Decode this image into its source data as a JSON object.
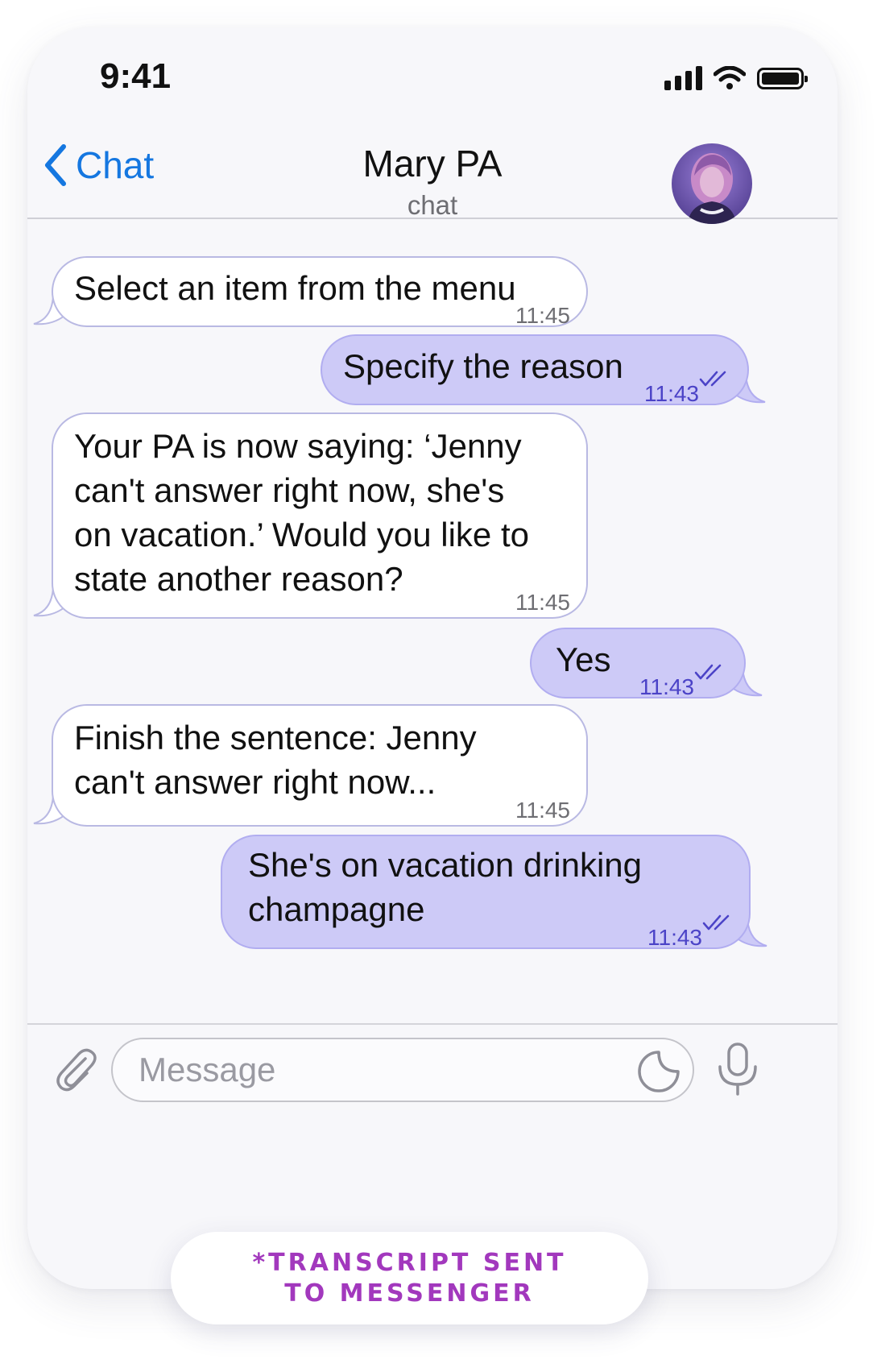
{
  "status_bar": {
    "time": "9:41"
  },
  "header": {
    "back_label": "Chat",
    "title": "Mary PA",
    "subtitle": "chat"
  },
  "messages": [
    {
      "direction": "incoming",
      "text": "Select an item from the menu",
      "time": "11:45"
    },
    {
      "direction": "outgoing",
      "text": "Specify the reason",
      "time": "11:43",
      "status": "read"
    },
    {
      "direction": "incoming",
      "text": "Your PA is now saying: ‘Jenny\ncan't answer right now, she's\non vacation.’ Would you like to\nstate another reason?",
      "time": "11:45"
    },
    {
      "direction": "outgoing",
      "text": "Yes",
      "time": "11:43",
      "status": "read"
    },
    {
      "direction": "incoming",
      "text": "Finish the sentence: Jenny\ncan't answer right now...",
      "time": "11:45"
    },
    {
      "direction": "outgoing",
      "text": "She's on vacation drinking\nchampagne",
      "time": "11:43",
      "status": "read"
    }
  ],
  "composer": {
    "placeholder": "Message"
  },
  "transcript_badge": {
    "line1": "*TRANSCRIPT SENT",
    "line2": "TO MESSENGER"
  },
  "colors": {
    "accent_blue": "#1577e0",
    "outgoing_bubble": "#cdcaf7",
    "incoming_border": "#b9b9e3",
    "read_tick": "#4b43c7",
    "badge_text": "#a238bd"
  }
}
